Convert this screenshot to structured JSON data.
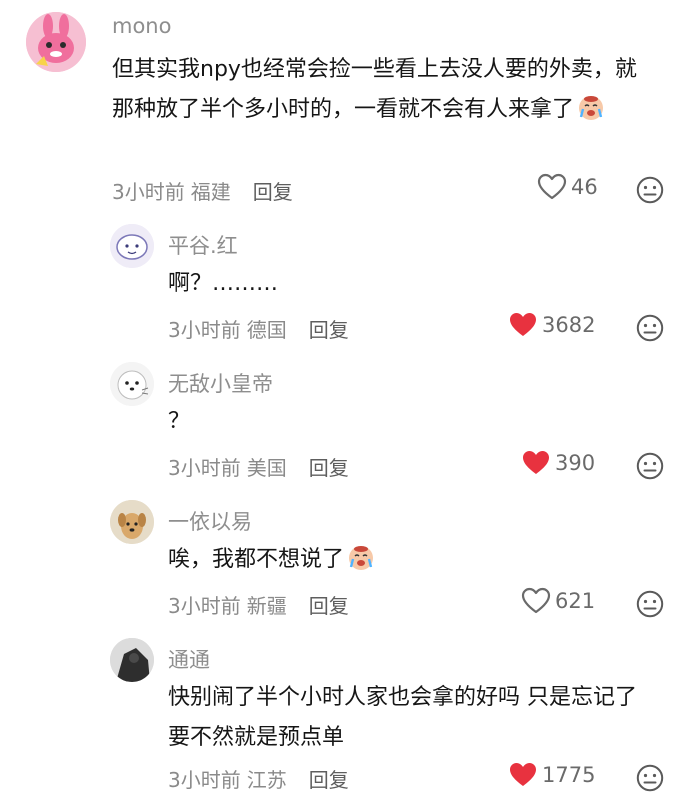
{
  "comments": [
    {
      "username": "mono",
      "text": "但其实我npy也经常会捡一些看上去没人要的外卖，就那种放了半个多小时的，一看就不会有人来拿了",
      "emoji": "crying-face-emoji",
      "time": "3小时前",
      "location": "福建",
      "reply_label": "回复",
      "likes": "46",
      "liked": false
    },
    {
      "username": "平谷.红",
      "text": "啊？………",
      "time": "3小时前",
      "location": "德国",
      "reply_label": "回复",
      "likes": "3682",
      "liked": true
    },
    {
      "username": "无敌小皇帝",
      "text": "？",
      "time": "3小时前",
      "location": "美国",
      "reply_label": "回复",
      "likes": "390",
      "liked": true
    },
    {
      "username": "一依以易",
      "text": "唉，我都不想说了",
      "emoji": "crying-face-emoji",
      "time": "3小时前",
      "location": "新疆",
      "reply_label": "回复",
      "likes": "621",
      "liked": false
    },
    {
      "username": "通通",
      "text": "快别闹了半个小时人家也会拿的好吗 只是忘记了要不然就是预点单",
      "time": "3小时前",
      "location": "江苏",
      "reply_label": "回复",
      "likes": "1775",
      "liked": true
    }
  ],
  "colors": {
    "liked_heart": "#e8323f",
    "outline_heart": "#6a6a6a",
    "username": "#8e8e8e",
    "meta": "#8a8a8a"
  }
}
